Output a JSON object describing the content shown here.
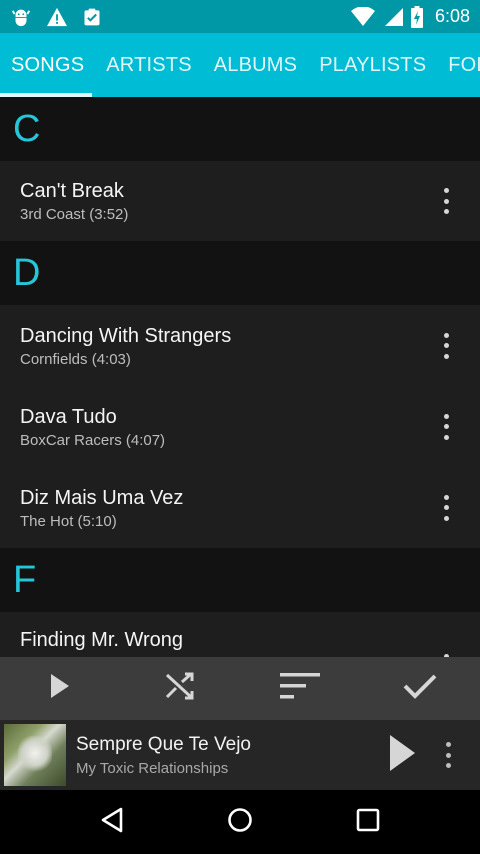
{
  "status_bar": {
    "time": "6:08",
    "icons": [
      "android-debug-icon",
      "warning-icon",
      "clipboard-check-icon",
      "wifi-icon",
      "signal-icon",
      "battery-charging-icon"
    ]
  },
  "tabs": [
    {
      "label": "SONGS",
      "active": true
    },
    {
      "label": "ARTISTS",
      "active": false
    },
    {
      "label": "ALBUMS",
      "active": false
    },
    {
      "label": "PLAYLISTS",
      "active": false
    },
    {
      "label": "FOL",
      "active": false
    }
  ],
  "sections": [
    {
      "letter": "C",
      "songs": [
        {
          "title": "Can't Break",
          "subtitle": "3rd Coast (3:52)"
        }
      ]
    },
    {
      "letter": "D",
      "songs": [
        {
          "title": "Dancing With Strangers",
          "subtitle": "Cornfields (4:03)"
        },
        {
          "title": "Dava Tudo",
          "subtitle": "BoxCar Racers (4:07)"
        },
        {
          "title": "Diz Mais Uma Vez",
          "subtitle": "The Hot (5:10)"
        }
      ]
    },
    {
      "letter": "F",
      "songs": [
        {
          "title": "Finding Mr. Wrong",
          "subtitle": ""
        }
      ]
    }
  ],
  "action_bar": {
    "icons": [
      "play-icon",
      "shuffle-icon",
      "sort-icon",
      "select-check-icon"
    ]
  },
  "now_playing": {
    "title": "Sempre Que Te Vejo",
    "artist": "My Toxic Relationships"
  },
  "nav_bar": {
    "icons": [
      "back-icon",
      "home-icon",
      "recents-icon"
    ]
  },
  "colors": {
    "status_bar": "#0097a7",
    "tab_bar": "#00bcd4",
    "section_letter": "#26c6da",
    "list_row": "#1e1e1e",
    "background": "#121212"
  }
}
